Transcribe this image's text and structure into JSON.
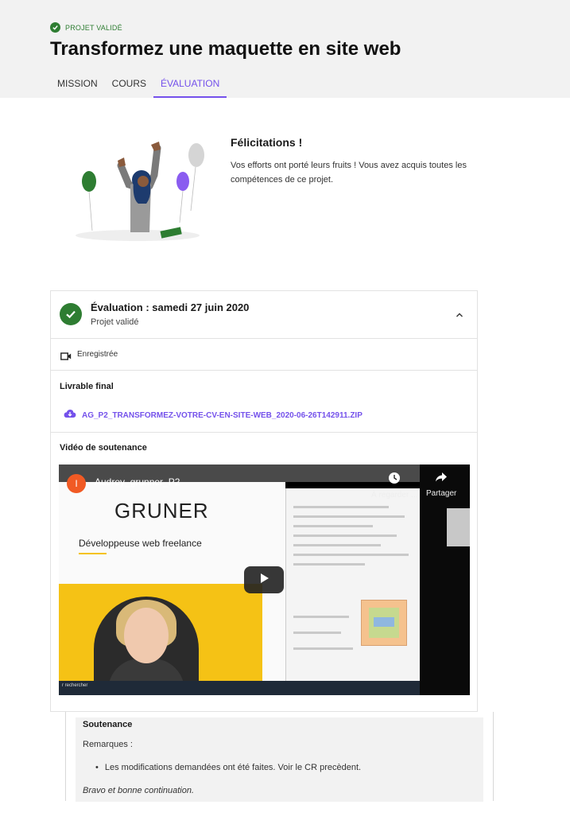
{
  "header": {
    "status_badge": "PROJET VALIDÉ",
    "title": "Transformez une maquette en site web",
    "tabs": [
      {
        "label": "MISSION",
        "active": false
      },
      {
        "label": "COURS",
        "active": false
      },
      {
        "label": "ÉVALUATION",
        "active": true
      }
    ]
  },
  "congrats": {
    "title": "Félicitations !",
    "text": "Vos efforts ont porté leurs fruits ! Vous avez acquis toutes les compétences de ce projet."
  },
  "evaluation": {
    "title": "Évaluation : samedi 27 juin 2020",
    "subtitle": "Projet validé",
    "recording_label": "Enregistrée",
    "deliverable_title": "Livrable final",
    "deliverable_link": "AG_P2_TRANSFORMEZ-VOTRE-CV-EN-SITE-WEB_2020-06-26T142911.ZIP",
    "video_title": "Vidéo de soutenance"
  },
  "video": {
    "channel_initial": "I",
    "title": "Audrey_grunner_P2",
    "watch_later": "À regarder ...",
    "share": "Partager",
    "frame_heading": "GRUNER",
    "frame_subheading": "Développeuse web freelance",
    "taskbar_search": "r rechercher"
  },
  "soutenance": {
    "title": "Soutenance",
    "remarks_label": "Remarques :",
    "remarks": [
      "Les modifications demandées ont été faites. Voir le CR precèdent."
    ],
    "closing": "Bravo et bonne continuation."
  },
  "colors": {
    "accent": "#7451eb",
    "success": "#2e7d32",
    "header_bg": "#f2f2f2"
  }
}
